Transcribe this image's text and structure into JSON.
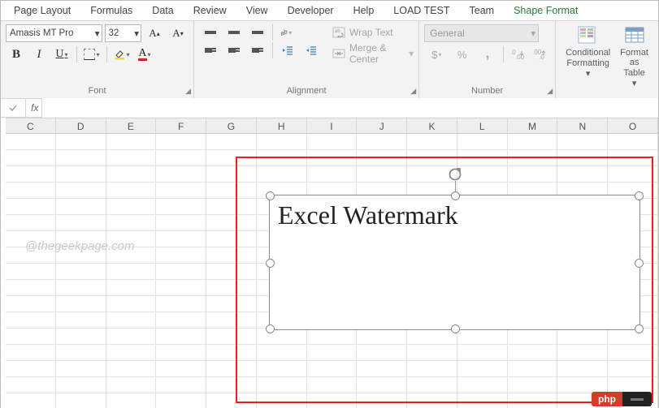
{
  "tabs": {
    "pageLayout": "Page Layout",
    "formulas": "Formulas",
    "data": "Data",
    "review": "Review",
    "view": "View",
    "developer": "Developer",
    "help": "Help",
    "loadTest": "LOAD TEST",
    "team": "Team",
    "shapeFormat": "Shape Format"
  },
  "font": {
    "name": "Amasis MT Pro",
    "size": "32",
    "increase": "A",
    "decrease": "A",
    "bold": "B",
    "italic": "I",
    "underline": "U",
    "fontColorLetter": "A",
    "groupLabel": "Font"
  },
  "alignment": {
    "wrapText": "Wrap Text",
    "mergeCenter": "Merge & Center",
    "groupLabel": "Alignment"
  },
  "number": {
    "format": "General",
    "groupLabel": "Number"
  },
  "styles": {
    "condFmt1": "Conditional",
    "condFmt2": "Formatting",
    "fmtTbl1": "Format as",
    "fmtTbl2": "Table"
  },
  "formulaBar": {
    "fx": "fx",
    "value": ""
  },
  "columns": [
    "C",
    "D",
    "E",
    "F",
    "G",
    "H",
    "I",
    "J",
    "K",
    "L",
    "M",
    "N",
    "O"
  ],
  "watermark": "@thegeekpage.com",
  "shapeText": "Excel Watermark",
  "badge": "php"
}
